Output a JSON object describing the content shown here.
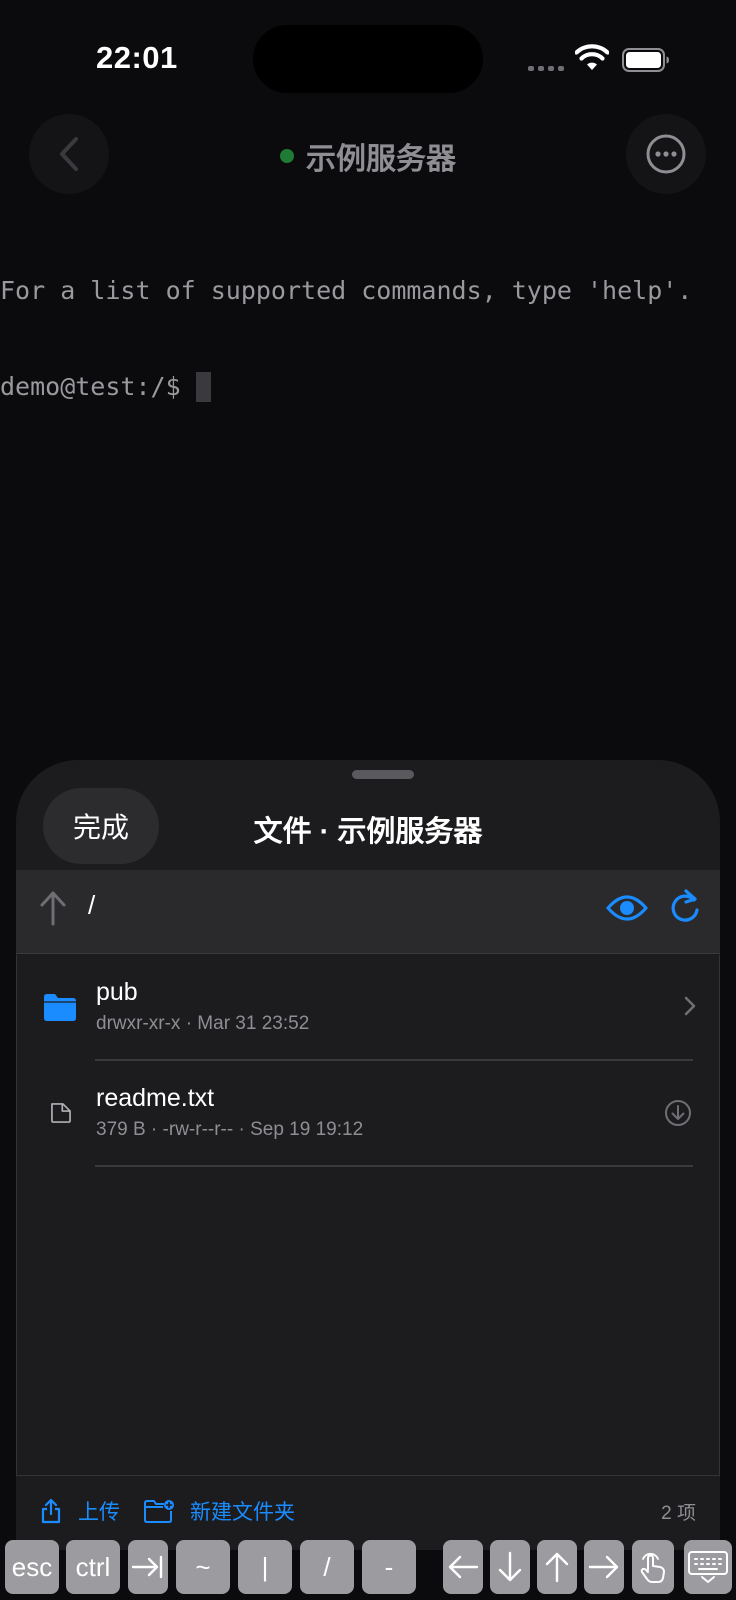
{
  "status_bar": {
    "time": "22:01"
  },
  "nav": {
    "title": "示例服务器",
    "status_color": "#1f7a33"
  },
  "terminal": {
    "lines": [
      "For a list of supported commands, type 'help'.",
      "demo@test:/$"
    ]
  },
  "sheet": {
    "done_label": "完成",
    "title": "文件 · 示例服务器",
    "path": "/",
    "files": [
      {
        "name": "pub",
        "meta": "drwxr-xr-x · Mar 31 23:52",
        "type": "folder",
        "icon": "folder-icon"
      },
      {
        "name": "readme.txt",
        "meta": "379 B · -rw-r--r-- · Sep 19 19:12",
        "type": "file",
        "icon": "file-icon"
      }
    ],
    "upload_label": "上传",
    "new_folder_label": "新建文件夹",
    "item_count": "2 项",
    "accent_color": "#1a8cff"
  },
  "keyboard_accessory": {
    "keys": [
      "esc",
      "ctrl",
      "tab-icon",
      "~",
      "|",
      "/",
      "-",
      "arrow-left-icon",
      "arrow-down-icon",
      "arrow-up-icon",
      "arrow-right-icon",
      "touch-icon",
      "keyboard-icon"
    ]
  }
}
